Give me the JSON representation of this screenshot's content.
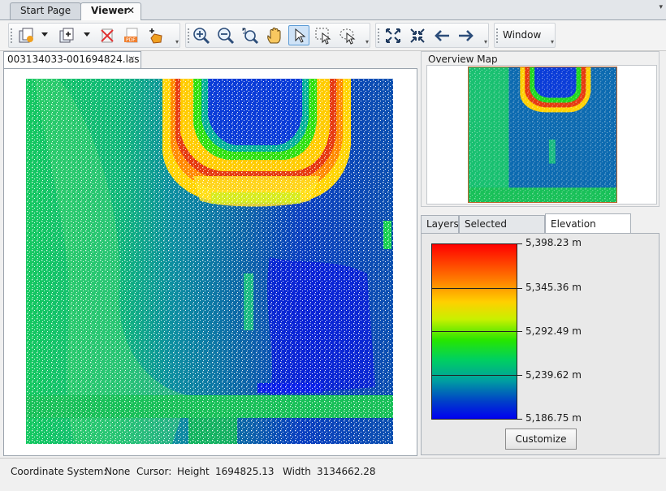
{
  "tabs": {
    "start_page": "Start Page",
    "viewer": "Viewer",
    "close_glyph": "✕",
    "menu_glyph": "▾"
  },
  "toolbar": {
    "window_label": "Window",
    "icons": [
      "add-file-icon",
      "add-layer-icon",
      "remove-layer-icon",
      "export-pdf-icon",
      "add-shape-icon",
      "zoom-in-icon",
      "zoom-out-icon",
      "zoom-extent-icon",
      "pan-hand-icon",
      "select-pointer-icon",
      "rectangle-select-icon",
      "lasso-select-icon",
      "zoom-full-icon",
      "zoom-fit-icon",
      "back-arrow-icon",
      "forward-arrow-icon"
    ]
  },
  "viewer": {
    "file_tab": "003134033-001694824.las"
  },
  "overview": {
    "label": "Overview Map"
  },
  "legend": {
    "tabs": [
      "Layers",
      "Selected Features",
      "Elevation Legend"
    ],
    "active_tab": "Elevation Legend",
    "values": [
      "5,398.23 m",
      "5,345.36 m",
      "5,292.49 m",
      "5,239.62 m",
      "5,186.75 m"
    ],
    "colors": {
      "high": "#ff0000",
      "mid": "#26e600",
      "low": "#0000f0"
    },
    "customize": "Customize"
  },
  "status": {
    "coord_label": "Coordinate System:",
    "coord_value": "None",
    "cursor_label": "Cursor:",
    "height_label": "Height",
    "height_value": "1694825.13",
    "width_label": "Width",
    "width_value": "3134662.28"
  }
}
